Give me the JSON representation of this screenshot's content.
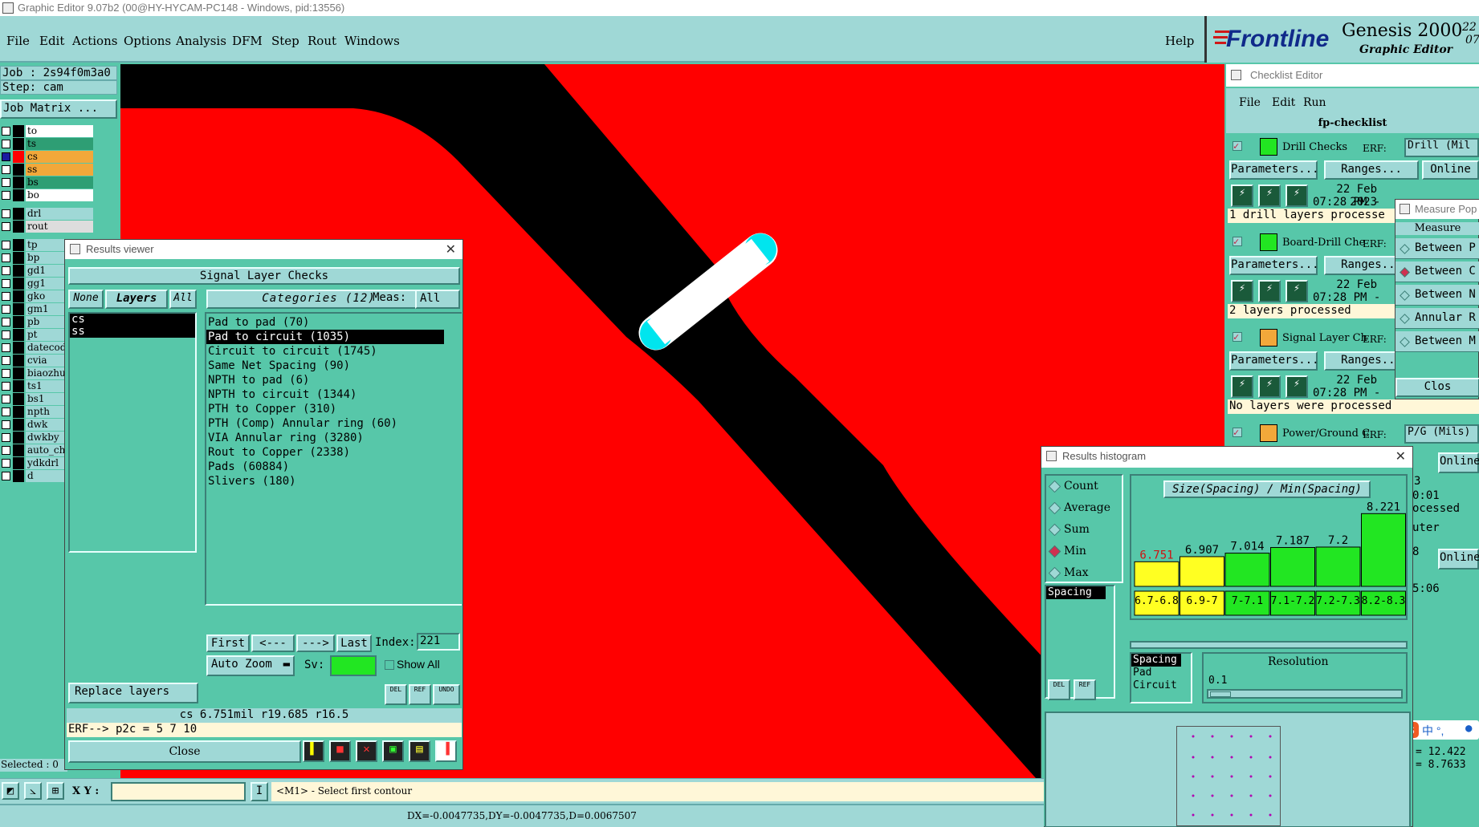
{
  "window": {
    "title": "Graphic Editor 9.07b2 (00@HY-HYCAM-PC148 - Windows, pid:13556)"
  },
  "menubar": {
    "items": [
      "File",
      "Edit",
      "Actions",
      "Options",
      "Analysis",
      "DFM",
      "Step",
      "Rout",
      "Windows"
    ],
    "help": "Help"
  },
  "brand": {
    "logo": "Frontline",
    "product": "Genesis 2000",
    "subtitle": "Graphic Editor",
    "version_top": "22",
    "version_bottom": "07"
  },
  "left_panel": {
    "job": "Job : 2s94f0m3a0",
    "step": "Step: cam",
    "job_matrix": "Job Matrix ...",
    "selected": "Selected : 0",
    "layers": [
      {
        "name": "to",
        "color": "#000000",
        "bg": "#ffffff"
      },
      {
        "name": "ts",
        "color": "#000000",
        "bg": "#2e9e74"
      },
      {
        "name": "cs",
        "color": "#ff0000",
        "bg": "#f2a83a"
      },
      {
        "name": "ss",
        "color": "#000000",
        "bg": "#f2a83a"
      },
      {
        "name": "bs",
        "color": "#000000",
        "bg": "#2e9e74"
      },
      {
        "name": "bo",
        "color": "#000000",
        "bg": "#ffffff"
      },
      {
        "name": "drl",
        "color": "#000000",
        "bg": "#9fd8d6"
      },
      {
        "name": "rout",
        "color": "#000000",
        "bg": "#dddddd"
      },
      {
        "name": "tp",
        "color": "#000000",
        "bg": "#9fd8d6"
      },
      {
        "name": "bp",
        "color": "#000000",
        "bg": "#9fd8d6"
      },
      {
        "name": "gd1",
        "color": "#000000",
        "bg": "#9fd8d6"
      },
      {
        "name": "gg1",
        "color": "#000000",
        "bg": "#9fd8d6"
      },
      {
        "name": "gko",
        "color": "#000000",
        "bg": "#9fd8d6"
      },
      {
        "name": "gm1",
        "color": "#000000",
        "bg": "#9fd8d6"
      },
      {
        "name": "pb",
        "color": "#000000",
        "bg": "#9fd8d6"
      },
      {
        "name": "pt",
        "color": "#000000",
        "bg": "#9fd8d6"
      },
      {
        "name": "datecod",
        "color": "#000000",
        "bg": "#9fd8d6"
      },
      {
        "name": "cvia",
        "color": "#000000",
        "bg": "#9fd8d6"
      },
      {
        "name": "biaozhu",
        "color": "#000000",
        "bg": "#9fd8d6"
      },
      {
        "name": "ts1",
        "color": "#000000",
        "bg": "#9fd8d6"
      },
      {
        "name": "bs1",
        "color": "#000000",
        "bg": "#9fd8d6"
      },
      {
        "name": "npth",
        "color": "#000000",
        "bg": "#9fd8d6"
      },
      {
        "name": "dwk",
        "color": "#000000",
        "bg": "#9fd8d6"
      },
      {
        "name": "dwkby",
        "color": "#000000",
        "bg": "#9fd8d6"
      },
      {
        "name": "auto_ch",
        "color": "#000000",
        "bg": "#9fd8d6"
      },
      {
        "name": "ydkdrl",
        "color": "#000000",
        "bg": "#9fd8d6"
      },
      {
        "name": "d",
        "color": "#000000",
        "bg": "#9fd8d6"
      }
    ]
  },
  "results_viewer": {
    "title": "Results viewer",
    "header": "Signal Layer Checks",
    "none_btn": "None",
    "layers_btn": "Layers",
    "all_btn": "All",
    "categories_label": "Categories (12)",
    "meas_label": "Meas:",
    "meas_value": "All",
    "layer_list": [
      "cs",
      "ss"
    ],
    "categories": [
      "Pad to pad (70)",
      "Pad to circuit (1035)",
      "Circuit to circuit (1745)",
      "Same Net Spacing (90)",
      "NPTH to pad (6)",
      "NPTH to circuit (1344)",
      "PTH to Copper (310)",
      "PTH (Comp) Annular ring (60)",
      "VIA Annular ring (3280)",
      "Rout to Copper (2338)",
      "Pads (60884)",
      "Slivers (180)"
    ],
    "selected_category": 1,
    "nav": {
      "first": "First",
      "prev": "<---",
      "next": "--->",
      "last": "Last",
      "index_label": "Index:",
      "index_value": "221"
    },
    "auto_zoom": "Auto Zoom",
    "sv_label": "Sv:",
    "show_all": "Show All",
    "replace_layers": "Replace layers",
    "icon_del": "DEL",
    "icon_ref": "REF",
    "icon_undo": "UNDO",
    "measure_line": "cs 6.751mil  r19.685  r16.5",
    "erf_line": "ERF--> p2c = 5 7 10",
    "close": "Close"
  },
  "checklist": {
    "title": "Checklist Editor",
    "menu": [
      "File",
      "Edit",
      "Run"
    ],
    "name": "fp-checklist",
    "erf_label": "ERF:",
    "parameters_btn": "Parameters...",
    "ranges_btn": "Ranges...",
    "online_btn": "Online",
    "checks": [
      {
        "name": "Drill Checks",
        "erf": "Drill (Mil",
        "date": "22 Feb 2023",
        "time": "07:28 PM -",
        "status": "1 drill layers processe"
      },
      {
        "name": "Board-Drill Che",
        "erf": "",
        "date": "22 Feb",
        "time": "07:28 PM -",
        "status": "2 layers processed"
      },
      {
        "name": "Signal Layer Ch",
        "erf": "",
        "date": "22 Feb",
        "time": "07:28 PM -",
        "status": "No layers were processed"
      },
      {
        "name": "Power/Ground C",
        "erf": "P/G (Mils)",
        "date": "",
        "time": "",
        "status": ""
      }
    ],
    "peek_texts": [
      "3",
      "0:01",
      "ocessed",
      "uter",
      "8",
      "5:06"
    ],
    "coords": [
      "= 12.422",
      "= 8.7633"
    ]
  },
  "measure_popup": {
    "title": "Measure Pop",
    "header": "Measure",
    "options": [
      "Between P",
      "Between C",
      "Between N",
      "Annular R",
      "Between M"
    ],
    "selected": 1,
    "close": "Clos"
  },
  "histogram": {
    "title": "Results histogram",
    "modes": [
      "Count",
      "Average",
      "Sum",
      "Min",
      "Max"
    ],
    "selected_mode": 3,
    "list": [
      "Spacing"
    ],
    "chart_title": "Size(Spacing) / Min(Spacing)",
    "spacing_list": [
      "Spacing",
      "Pad",
      "Circuit"
    ],
    "resolution_label": "Resolution",
    "resolution_value": "0.1",
    "icon_del": "DEL",
    "icon_ref": "REF"
  },
  "chart_data": {
    "type": "bar",
    "title": "Size(Spacing) / Min(Spacing)",
    "categories": [
      "6.7-6.8",
      "6.9-7",
      "7-7.1",
      "7.1-7.2",
      "7.2-7.3",
      "8.2-8.3"
    ],
    "values": [
      6.751,
      6.907,
      7.014,
      7.187,
      7.2,
      8.221
    ],
    "value_labels": [
      "6.751",
      "6.907",
      "7.014",
      "7.187",
      "7.2",
      "8.221"
    ],
    "bar_colors": [
      "#ffff22",
      "#ffff22",
      "#22e622",
      "#22e622",
      "#22e622",
      "#22e622"
    ],
    "ylim": [
      0,
      9
    ]
  },
  "cmdbar": {
    "xy_label": "X Y :",
    "prompt": "<M1> - Select first contour"
  },
  "statusbar": {
    "text": "DX=-0.0047735,DY=-0.0047735,D=0.0067507"
  },
  "tray": {
    "ime_text": "中 °,",
    "mic": "mic"
  },
  "colors": {
    "teal": "#57c7a9",
    "light_teal": "#9fd8d6",
    "copper": "#ff0000",
    "highlight": "#00e5ee"
  }
}
